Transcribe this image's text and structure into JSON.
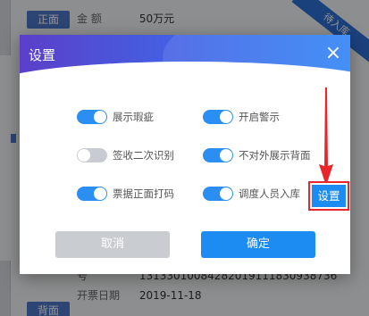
{
  "background": {
    "front_tag": "正面",
    "back_tag": "背面",
    "corner_ribbon": "待入库",
    "rows": [
      {
        "label": "金    额",
        "value": "50万元"
      },
      {
        "label": "号",
        "value": "131330100842820191118309387​36"
      },
      {
        "label": "开票日期",
        "value": "2019-11-18"
      }
    ]
  },
  "dialog": {
    "title": "设置",
    "close_label": "×",
    "options": [
      {
        "label": "展示瑕疵",
        "on": true
      },
      {
        "label": "开启警示",
        "on": true
      },
      {
        "label": "签收二次识别",
        "on": false
      },
      {
        "label": "不对外展示背面",
        "on": true
      },
      {
        "label": "票据正面打码",
        "on": true
      },
      {
        "label": "调度人员入库",
        "on": true
      }
    ],
    "cancel_label": "取消",
    "ok_label": "确定"
  },
  "annotation": {
    "settings_button_label": "设置",
    "highlight_color": "#e8262b"
  },
  "colors": {
    "primary": "#1d8cf2",
    "toggle_on": "#2a8ef2",
    "toggle_off": "#c8ccd2",
    "cancel": "#c9ccd1"
  }
}
